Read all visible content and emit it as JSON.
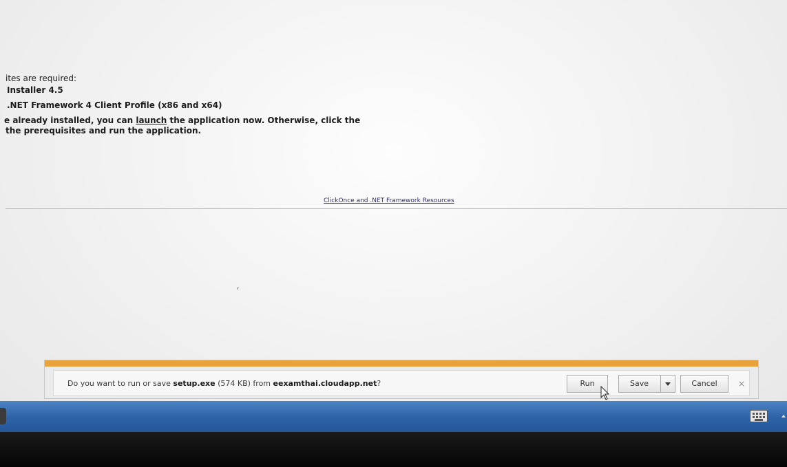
{
  "page": {
    "requirements_heading": "ites are required:",
    "items": [
      "Installer 4.5",
      ".NET Framework 4 Client Profile (x86 and x64)"
    ],
    "instruction_line1_prefix": "e already installed, you can ",
    "instruction_link": "launch",
    "instruction_line1_suffix": " the application now. Otherwise, click the",
    "instruction_line2": "the prerequisites and run the application.",
    "resources_link": "ClickOnce and .NET Framework Resources"
  },
  "notification": {
    "msg_prefix": "Do you want to run or save ",
    "file_name": "setup.exe",
    "file_size": " (574 KB) from ",
    "domain": "eexamthai.cloudapp.net",
    "msg_suffix": "?",
    "run_label": "Run",
    "save_label": "Save",
    "cancel_label": "Cancel",
    "close_label": "×"
  },
  "icons": {
    "close": "close-icon",
    "dropdown": "chevron-down-icon",
    "cursor": "cursor-icon",
    "keyboard": "keyboard-icon",
    "tray": "chevron-up-icon"
  },
  "colors": {
    "notify_stripe": "#e8a13b",
    "taskbar": "#2d63a6",
    "link": "#2d2d6e"
  }
}
